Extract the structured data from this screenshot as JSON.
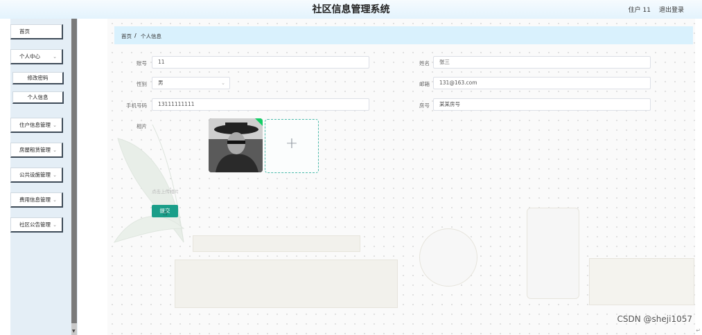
{
  "header": {
    "title": "社区信息管理系统",
    "user": "住户 11",
    "logout": "退出登录"
  },
  "sidebar": {
    "items": [
      {
        "label": "首页"
      },
      {
        "label": "个人中心",
        "children": [
          "修改密码",
          "个人信息"
        ]
      },
      {
        "label": "住户信息管理"
      },
      {
        "label": "房屋租赁管理"
      },
      {
        "label": "公共设施管理"
      },
      {
        "label": "费用信息管理"
      },
      {
        "label": "社区公告管理"
      }
    ]
  },
  "breadcrumb": {
    "home": "首页",
    "separator": "/",
    "current": "个人信息"
  },
  "form": {
    "account_label": "账号",
    "account_value": "11",
    "name_label": "姓名",
    "name_value": "张三",
    "gender_label": "性别",
    "gender_value": "男",
    "email_label": "邮箱",
    "email_value": "131@163.com",
    "phone_label": "手机号码",
    "phone_value": "13111111111",
    "room_label": "房号",
    "room_value": "某某房号",
    "photo_label": "相片",
    "upload_hint": "点击上传相片",
    "submit_label": "提交"
  },
  "icons": {
    "plus": "plus-icon",
    "chevron": "chevron-down-icon",
    "check": "check-icon"
  },
  "colors": {
    "primary": "#1a9e89",
    "breadcrumb_bg": "#d9f1fd",
    "upload_border": "#49b9a9"
  },
  "watermark": "CSDN @sheji1057"
}
